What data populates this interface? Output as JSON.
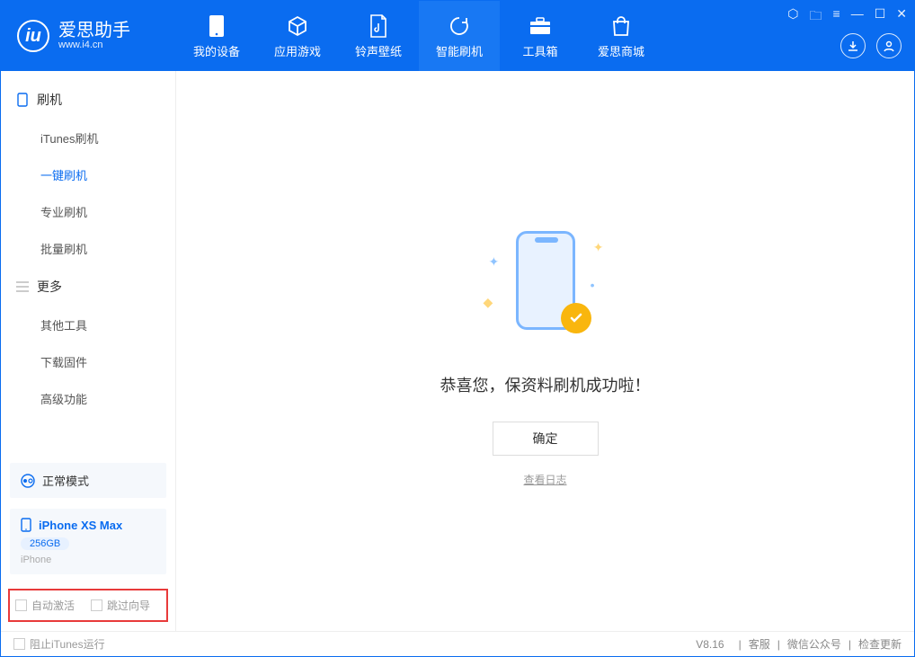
{
  "app": {
    "name": "爱思助手",
    "domain": "www.i4.cn"
  },
  "nav": {
    "tabs": [
      {
        "label": "我的设备"
      },
      {
        "label": "应用游戏"
      },
      {
        "label": "铃声壁纸"
      },
      {
        "label": "智能刷机"
      },
      {
        "label": "工具箱"
      },
      {
        "label": "爱思商城"
      }
    ]
  },
  "sidebar": {
    "group1": {
      "title": "刷机",
      "items": [
        "iTunes刷机",
        "一键刷机",
        "专业刷机",
        "批量刷机"
      ]
    },
    "group2": {
      "title": "更多",
      "items": [
        "其他工具",
        "下载固件",
        "高级功能"
      ]
    },
    "mode": "正常模式",
    "device": {
      "name": "iPhone XS Max",
      "storage": "256GB",
      "type": "iPhone"
    },
    "checks": {
      "auto_activate": "自动激活",
      "skip_guide": "跳过向导"
    }
  },
  "main": {
    "success": "恭喜您，保资料刷机成功啦！",
    "ok": "确定",
    "view_log": "查看日志"
  },
  "footer": {
    "block_itunes": "阻止iTunes运行",
    "version": "V8.16",
    "links": [
      "客服",
      "微信公众号",
      "检查更新"
    ]
  }
}
